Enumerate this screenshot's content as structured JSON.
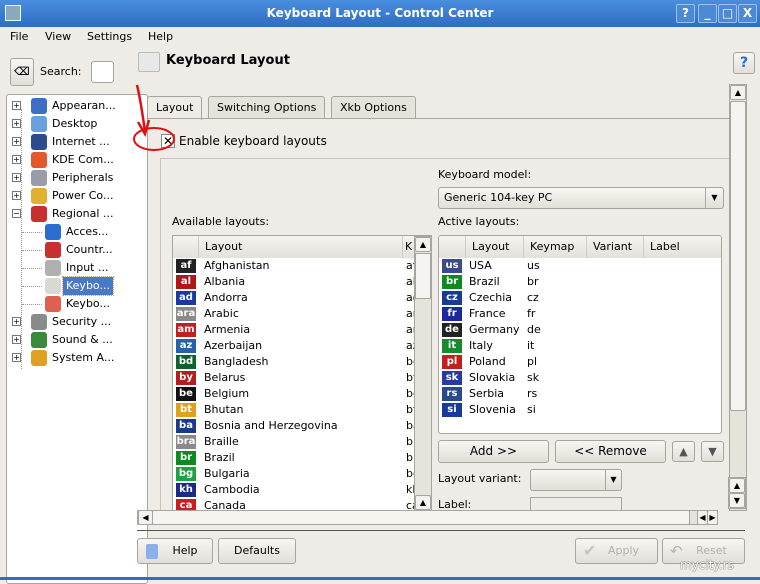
{
  "window": {
    "title": "Keyboard Layout - Control Center",
    "buttons": [
      "?",
      "_",
      "□",
      "X"
    ]
  },
  "menu": [
    "File",
    "View",
    "Settings",
    "Help"
  ],
  "search": {
    "label": "Search:",
    "value": ""
  },
  "tree": [
    {
      "label": "Appearan...",
      "expander": "+",
      "color": "#3a6fc4",
      "level": 0
    },
    {
      "label": "Desktop",
      "expander": "+",
      "color": "#6aa0e0",
      "level": 0
    },
    {
      "label": "Internet ...",
      "expander": "+",
      "color": "#2b4c8c",
      "level": 0
    },
    {
      "label": "KDE Com...",
      "expander": "+",
      "color": "#e05a2a",
      "level": 0
    },
    {
      "label": "Peripherals",
      "expander": "+",
      "color": "#9a9aa8",
      "level": 0
    },
    {
      "label": "Power Co...",
      "expander": "+",
      "color": "#e0b030",
      "level": 0
    },
    {
      "label": "Regional ...",
      "expander": "−",
      "color": "#c83030",
      "level": 0
    },
    {
      "label": "Acces...",
      "color": "#2a6cd0",
      "level": 1
    },
    {
      "label": "Countr...",
      "color": "#c83030",
      "level": 1
    },
    {
      "label": "Input ...",
      "color": "#b0b0b0",
      "level": 1
    },
    {
      "label": "Keybo...",
      "color": "#d8d8d8",
      "level": 1,
      "selected": true
    },
    {
      "label": "Keybo...",
      "color": "#e06050",
      "level": 1
    },
    {
      "label": "Security ...",
      "expander": "+",
      "color": "#8a8a8a",
      "level": 0
    },
    {
      "label": "Sound & ...",
      "expander": "+",
      "color": "#3a8a3a",
      "level": 0
    },
    {
      "label": "System A...",
      "expander": "+",
      "color": "#e0a020",
      "level": 0
    }
  ],
  "header": {
    "title": "Keyboard Layout"
  },
  "tabs": [
    "Layout",
    "Switching Options",
    "Xkb Options"
  ],
  "enable_label": "Enable keyboard layouts",
  "keyboard_model": {
    "label": "Keyboard model:",
    "value": "Generic 104-key PC"
  },
  "available": {
    "label": "Available layouts:",
    "columns": [
      "Layout",
      "K"
    ],
    "rows": [
      {
        "code": "af",
        "name": "Afghanistan",
        "km": "af",
        "bg": "#222",
        "fg": "#fff"
      },
      {
        "code": "al",
        "name": "Albania",
        "km": "al",
        "bg": "#b01818"
      },
      {
        "code": "ad",
        "name": "Andorra",
        "km": "ad",
        "bg": "#1a3aa0"
      },
      {
        "code": "ara",
        "name": "Arabic",
        "km": "ara",
        "bg": "#8a8a8a"
      },
      {
        "code": "am",
        "name": "Armenia",
        "km": "am",
        "bg": "#c02020"
      },
      {
        "code": "az",
        "name": "Azerbaijan",
        "km": "az",
        "bg": "#2a60a8"
      },
      {
        "code": "bd",
        "name": "Bangladesh",
        "km": "bd",
        "bg": "#106030"
      },
      {
        "code": "by",
        "name": "Belarus",
        "km": "by",
        "bg": "#b02020"
      },
      {
        "code": "be",
        "name": "Belgium",
        "km": "be",
        "bg": "#111"
      },
      {
        "code": "bt",
        "name": "Bhutan",
        "km": "bt",
        "bg": "#e0a020"
      },
      {
        "code": "ba",
        "name": "Bosnia and Herzegovina",
        "km": "ba",
        "bg": "#1a3a8a"
      },
      {
        "code": "bra",
        "name": "Braille",
        "km": "brai",
        "bg": "#8a8a8a"
      },
      {
        "code": "br",
        "name": "Brazil",
        "km": "br",
        "bg": "#108a20"
      },
      {
        "code": "bg",
        "name": "Bulgaria",
        "km": "bg",
        "bg": "#20a040"
      },
      {
        "code": "kh",
        "name": "Cambodia",
        "km": "kh",
        "bg": "#1a2a8a"
      },
      {
        "code": "ca",
        "name": "Canada",
        "km": "ca",
        "bg": "#c82020"
      }
    ]
  },
  "active": {
    "label": "Active layouts:",
    "columns": [
      "Layout",
      "Keymap",
      "Variant",
      "Label"
    ],
    "rows": [
      {
        "code": "us",
        "name": "USA",
        "km": "us",
        "bg": "#3a4a8a"
      },
      {
        "code": "br",
        "name": "Brazil",
        "km": "br",
        "bg": "#108a20"
      },
      {
        "code": "cz",
        "name": "Czechia",
        "km": "cz",
        "bg": "#1a3a8a"
      },
      {
        "code": "fr",
        "name": "France",
        "km": "fr",
        "bg": "#1a2a9a"
      },
      {
        "code": "de",
        "name": "Germany",
        "km": "de",
        "bg": "#222"
      },
      {
        "code": "it",
        "name": "Italy",
        "km": "it",
        "bg": "#1a8a30"
      },
      {
        "code": "pl",
        "name": "Poland",
        "km": "pl",
        "bg": "#c02020"
      },
      {
        "code": "sk",
        "name": "Slovakia",
        "km": "sk",
        "bg": "#2a3a9a"
      },
      {
        "code": "rs",
        "name": "Serbia",
        "km": "rs",
        "bg": "#2a4a8a"
      },
      {
        "code": "si",
        "name": "Slovenia",
        "km": "si",
        "bg": "#1a3a9a"
      }
    ]
  },
  "buttons": {
    "add": "Add >>",
    "remove": "<< Remove",
    "help": "Help",
    "defaults": "Defaults",
    "apply": "Apply",
    "reset": "Reset"
  },
  "layout_variant": {
    "label": "Layout variant:",
    "value": ""
  },
  "label_field": {
    "label": "Label:",
    "value": ""
  },
  "watermark": "mycity.rs"
}
